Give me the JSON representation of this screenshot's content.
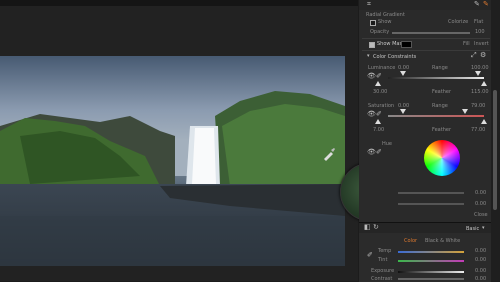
{
  "colors": {
    "accent": "#e07a2f",
    "panel": "#2a2a2a",
    "canvas": "#222222"
  },
  "panel": {
    "gradient_section": {
      "title": "Radial Gradient",
      "show_label": "Show",
      "colorize_label": "Colorize",
      "colorize_value": "Flat",
      "opacity_label": "Opacity",
      "opacity_value": "100"
    },
    "show_mask": {
      "label": "Show Mask",
      "fill_label": "Fill",
      "invert_label": "Invert"
    },
    "color_constraints": {
      "title": "Color Constraints",
      "luminance": {
        "label": "Luminance",
        "low": "0.00",
        "range_label": "Range",
        "high": "100.00",
        "feather_low": "30.00",
        "feather_label": "Feather",
        "feather_high": "115.00"
      },
      "saturation": {
        "label": "Saturation",
        "low": "0.00",
        "range_label": "Range",
        "high": "79.00",
        "feather_low": "7.00",
        "feather_label": "Feather",
        "feather_high": "77.00"
      },
      "hue_label": "Hue",
      "slider_values": [
        "0.00",
        "0.00"
      ],
      "close_label": "Close"
    }
  },
  "bottom": {
    "preset": "Basic",
    "tabs": [
      "Color",
      "Black & White"
    ],
    "rows": [
      {
        "label": "Temp",
        "value": "0.00"
      },
      {
        "label": "Tint",
        "value": "0.00"
      },
      {
        "label": "Exposure",
        "value": "0.00"
      },
      {
        "label": "Contrast",
        "value": "0.00"
      }
    ]
  }
}
